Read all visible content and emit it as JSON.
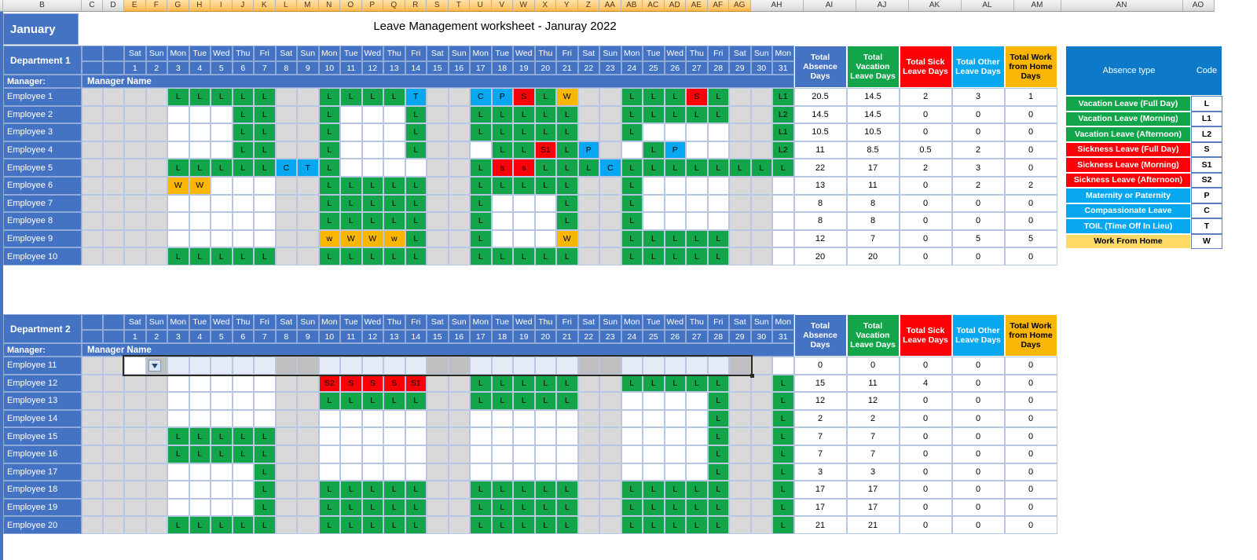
{
  "spreadsheet": {
    "title": "Leave Management worksheet - Januray 2022",
    "month": "January",
    "column_headers": [
      "B",
      "C",
      "D",
      "E",
      "F",
      "G",
      "H",
      "I",
      "J",
      "K",
      "L",
      "M",
      "N",
      "O",
      "P",
      "Q",
      "R",
      "S",
      "T",
      "U",
      "V",
      "W",
      "X",
      "Y",
      "Z",
      "AA",
      "AB",
      "AC",
      "AD",
      "AE",
      "AF",
      "AG",
      "AH",
      "AI",
      "AJ",
      "AK",
      "AL",
      "AM",
      "AN",
      "AO"
    ],
    "selected_column": "AG",
    "day_names": [
      "Sat",
      "Sun",
      "Mon",
      "Tue",
      "Wed",
      "Thu",
      "Fri",
      "Sat",
      "Sun",
      "Mon",
      "Tue",
      "Wed",
      "Thu",
      "Fri",
      "Sat",
      "Sun",
      "Mon",
      "Tue",
      "Wed",
      "Thu",
      "Fri",
      "Sat",
      "Sun",
      "Mon",
      "Tue",
      "Wed",
      "Thu",
      "Fri",
      "Sat",
      "Sun",
      "Mon"
    ],
    "day_numbers": [
      "1",
      "2",
      "3",
      "4",
      "5",
      "6",
      "7",
      "8",
      "9",
      "10",
      "11",
      "12",
      "13",
      "14",
      "15",
      "16",
      "17",
      "18",
      "19",
      "20",
      "21",
      "22",
      "23",
      "24",
      "25",
      "26",
      "27",
      "28",
      "29",
      "30",
      "31"
    ],
    "weekend_indices": [
      0,
      1,
      7,
      8,
      14,
      15,
      21,
      22,
      28,
      29
    ],
    "summary_headers": [
      {
        "label": "Total Absence Days",
        "color": "#4573c4",
        "style": "b"
      },
      {
        "label": "Total Vacation Leave Days",
        "color": "#12a54a",
        "style": "g"
      },
      {
        "label": "Total Sick Leave Days",
        "color": "#fb0007",
        "style": "r"
      },
      {
        "label": "Total Other Leave Days",
        "color": "#08a8f0",
        "style": "lb"
      },
      {
        "label": "Total Work from Home Days",
        "color": "#f9b604",
        "style": "y"
      }
    ],
    "manager_label": "Manager:",
    "manager_name": "Manager Name"
  },
  "legend": {
    "header_type": "Absence type",
    "header_code": "Code",
    "rows": [
      {
        "label": "Vacation Leave (Full Day)",
        "code": "L",
        "style": "green"
      },
      {
        "label": "Vacation Leave (Morning)",
        "code": "L1",
        "style": "green"
      },
      {
        "label": "Vacation Leave (Afternoon)",
        "code": "L2",
        "style": "green"
      },
      {
        "label": "Sickness Leave (Full Day)",
        "code": "S",
        "style": "red"
      },
      {
        "label": "Sickness Leave (Morning)",
        "code": "S1",
        "style": "red"
      },
      {
        "label": "Sickness Leave (Afternoon)",
        "code": "S2",
        "style": "red"
      },
      {
        "label": "Maternity or Paternity",
        "code": "P",
        "style": "blue"
      },
      {
        "label": "Compassionate Leave",
        "code": "C",
        "style": "blue"
      },
      {
        "label": "TOIL (Time Off In Lieu)",
        "code": "T",
        "style": "blue"
      },
      {
        "label": "Work From Home",
        "code": "W",
        "style": "yell"
      }
    ]
  },
  "departments": [
    {
      "name": "Department 1",
      "employees": [
        {
          "name": "Employee 1",
          "days": [
            "",
            "",
            "L",
            "L",
            "L",
            "L",
            "L",
            "",
            "",
            "L",
            "L",
            "L",
            "L",
            "T",
            "",
            "",
            "C",
            "P",
            "S",
            "L",
            "W",
            "",
            "",
            "L",
            "L",
            "L",
            "S",
            "L",
            "",
            "",
            "L1"
          ],
          "totals": [
            "20.5",
            "14.5",
            "2",
            "3",
            "1"
          ]
        },
        {
          "name": "Employee 2",
          "days": [
            "",
            "",
            "",
            "",
            "",
            "L",
            "L",
            "",
            "",
            "L",
            "",
            "",
            "",
            "L",
            "",
            "",
            "L",
            "L",
            "L",
            "L",
            "L",
            "",
            "",
            "L",
            "L",
            "L",
            "L",
            "L",
            "",
            "",
            "L2"
          ],
          "totals": [
            "14.5",
            "14.5",
            "0",
            "0",
            "0"
          ]
        },
        {
          "name": "Employee 3",
          "days": [
            "",
            "",
            "",
            "",
            "",
            "L",
            "L",
            "",
            "",
            "L",
            "",
            "",
            "",
            "L",
            "",
            "",
            "L",
            "L",
            "L",
            "L",
            "L",
            "",
            "",
            "L",
            "",
            "",
            "",
            "",
            "",
            "",
            "L1"
          ],
          "totals": [
            "10.5",
            "10.5",
            "0",
            "0",
            "0"
          ]
        },
        {
          "name": "Employee 4",
          "days": [
            "",
            "",
            "",
            "",
            "",
            "L",
            "L",
            "",
            "",
            "L",
            "",
            "",
            "",
            "L",
            "",
            "",
            "",
            "L",
            "L",
            "S1",
            "L",
            "P",
            "",
            "",
            "L",
            "P",
            "",
            "",
            "",
            "",
            "L2"
          ],
          "totals": [
            "11",
            "8.5",
            "0.5",
            "2",
            "0"
          ]
        },
        {
          "name": "Employee 5",
          "days": [
            "",
            "",
            "L",
            "L",
            "L",
            "L",
            "L",
            "C",
            "T",
            "L",
            "",
            "",
            "",
            "",
            "",
            "",
            "L",
            "s",
            "s",
            "L",
            "L",
            "L",
            "C",
            "L",
            "L",
            "L",
            "L",
            "L",
            "L",
            "L",
            "L"
          ],
          "totals": [
            "22",
            "17",
            "2",
            "3",
            "0"
          ]
        },
        {
          "name": "Employee 6",
          "days": [
            "",
            "",
            "W",
            "W",
            "",
            "",
            "",
            "",
            "",
            "L",
            "L",
            "L",
            "L",
            "L",
            "",
            "",
            "L",
            "L",
            "L",
            "L",
            "L",
            "",
            "",
            "L",
            "",
            "",
            "",
            "",
            "",
            "",
            ""
          ],
          "totals": [
            "13",
            "11",
            "0",
            "2",
            "2"
          ]
        },
        {
          "name": "Employee 7",
          "days": [
            "",
            "",
            "",
            "",
            "",
            "",
            "",
            "",
            "",
            "L",
            "L",
            "L",
            "L",
            "L",
            "",
            "",
            "L",
            "",
            "",
            "",
            "L",
            "",
            "",
            "L",
            "",
            "",
            "",
            "",
            "",
            "",
            ""
          ],
          "totals": [
            "8",
            "8",
            "0",
            "0",
            "0"
          ]
        },
        {
          "name": "Employee 8",
          "days": [
            "",
            "",
            "",
            "",
            "",
            "",
            "",
            "",
            "",
            "L",
            "L",
            "L",
            "L",
            "L",
            "",
            "",
            "L",
            "",
            "",
            "",
            "L",
            "",
            "",
            "L",
            "",
            "",
            "",
            "",
            "",
            "",
            ""
          ],
          "totals": [
            "8",
            "8",
            "0",
            "0",
            "0"
          ]
        },
        {
          "name": "Employee 9",
          "days": [
            "",
            "",
            "",
            "",
            "",
            "",
            "",
            "",
            "",
            "w",
            "W",
            "W",
            "w",
            "L",
            "",
            "",
            "L",
            "",
            "",
            "",
            "W",
            "",
            "",
            "L",
            "L",
            "L",
            "L",
            "L",
            "",
            "",
            ""
          ],
          "totals": [
            "12",
            "7",
            "0",
            "5",
            "5"
          ]
        },
        {
          "name": "Employee 10",
          "days": [
            "",
            "",
            "L",
            "L",
            "L",
            "L",
            "L",
            "",
            "",
            "L",
            "L",
            "L",
            "L",
            "L",
            "",
            "",
            "L",
            "L",
            "L",
            "L",
            "L",
            "",
            "",
            "L",
            "L",
            "L",
            "L",
            "L",
            "",
            "",
            ""
          ],
          "totals": [
            "20",
            "20",
            "0",
            "0",
            "0"
          ]
        }
      ]
    },
    {
      "name": "Department 2",
      "employees": [
        {
          "name": "Employee 11",
          "days": [
            "",
            "",
            "",
            "",
            "",
            "",
            "",
            "",
            "",
            "",
            "",
            "",
            "",
            "",
            "",
            "",
            "",
            "",
            "",
            "",
            "",
            "",
            "",
            "",
            "",
            "",
            "",
            "",
            "",
            "",
            ""
          ],
          "totals": [
            "0",
            "0",
            "0",
            "0",
            "0"
          ],
          "selected": true
        },
        {
          "name": "Employee 12",
          "days": [
            "",
            "",
            "",
            "",
            "",
            "",
            "",
            "",
            "",
            "S2",
            "S",
            "S",
            "S",
            "S1",
            "",
            "",
            "L",
            "L",
            "L",
            "L",
            "L",
            "",
            "",
            "L",
            "L",
            "L",
            "L",
            "L",
            "",
            "",
            "L"
          ],
          "totals": [
            "15",
            "11",
            "4",
            "0",
            "0"
          ]
        },
        {
          "name": "Employee 13",
          "days": [
            "",
            "",
            "",
            "",
            "",
            "",
            "",
            "",
            "",
            "L",
            "L",
            "L",
            "L",
            "L",
            "",
            "",
            "L",
            "L",
            "L",
            "L",
            "L",
            "",
            "",
            "",
            "",
            "",
            "",
            "L",
            "",
            "",
            "L"
          ],
          "totals": [
            "12",
            "12",
            "0",
            "0",
            "0"
          ]
        },
        {
          "name": "Employee 14",
          "days": [
            "",
            "",
            "",
            "",
            "",
            "",
            "",
            "",
            "",
            "",
            "",
            "",
            "",
            "",
            "",
            "",
            "",
            "",
            "",
            "",
            "",
            "",
            "",
            "",
            "",
            "",
            "",
            "L",
            "",
            "",
            "L"
          ],
          "totals": [
            "2",
            "2",
            "0",
            "0",
            "0"
          ]
        },
        {
          "name": "Employee 15",
          "days": [
            "",
            "",
            "L",
            "L",
            "L",
            "L",
            "L",
            "",
            "",
            "",
            "",
            "",
            "",
            "",
            "",
            "",
            "",
            "",
            "",
            "",
            "",
            "",
            "",
            "",
            "",
            "",
            "",
            "L",
            "",
            "",
            "L"
          ],
          "totals": [
            "7",
            "7",
            "0",
            "0",
            "0"
          ]
        },
        {
          "name": "Employee 16",
          "days": [
            "",
            "",
            "L",
            "L",
            "L",
            "L",
            "L",
            "",
            "",
            "",
            "",
            "",
            "",
            "",
            "",
            "",
            "",
            "",
            "",
            "",
            "",
            "",
            "",
            "",
            "",
            "",
            "",
            "L",
            "",
            "",
            "L"
          ],
          "totals": [
            "7",
            "7",
            "0",
            "0",
            "0"
          ]
        },
        {
          "name": "Employee 17",
          "days": [
            "",
            "",
            "",
            "",
            "",
            "",
            "L",
            "",
            "",
            "",
            "",
            "",
            "",
            "",
            "",
            "",
            "",
            "",
            "",
            "",
            "",
            "",
            "",
            "",
            "",
            "",
            "",
            "L",
            "",
            "",
            "L"
          ],
          "totals": [
            "3",
            "3",
            "0",
            "0",
            "0"
          ]
        },
        {
          "name": "Employee 18",
          "days": [
            "",
            "",
            "",
            "",
            "",
            "",
            "L",
            "",
            "",
            "L",
            "L",
            "L",
            "L",
            "L",
            "",
            "",
            "L",
            "L",
            "L",
            "L",
            "L",
            "",
            "",
            "L",
            "L",
            "L",
            "L",
            "L",
            "",
            "",
            "L"
          ],
          "totals": [
            "17",
            "17",
            "0",
            "0",
            "0"
          ]
        },
        {
          "name": "Employee 19",
          "days": [
            "",
            "",
            "",
            "",
            "",
            "",
            "L",
            "",
            "",
            "L",
            "L",
            "L",
            "L",
            "L",
            "",
            "",
            "L",
            "L",
            "L",
            "L",
            "L",
            "",
            "",
            "L",
            "L",
            "L",
            "L",
            "L",
            "",
            "",
            "L"
          ],
          "totals": [
            "17",
            "17",
            "0",
            "0",
            "0"
          ]
        },
        {
          "name": "Employee 20",
          "days": [
            "",
            "",
            "L",
            "L",
            "L",
            "L",
            "L",
            "",
            "",
            "L",
            "L",
            "L",
            "L",
            "L",
            "",
            "",
            "L",
            "L",
            "L",
            "L",
            "L",
            "",
            "",
            "L",
            "L",
            "L",
            "L",
            "L",
            "",
            "",
            "L"
          ],
          "totals": [
            "21",
            "21",
            "0",
            "0",
            "0"
          ]
        }
      ]
    }
  ],
  "active_cell": {
    "dropdown_icon": "chevron-down-icon"
  }
}
